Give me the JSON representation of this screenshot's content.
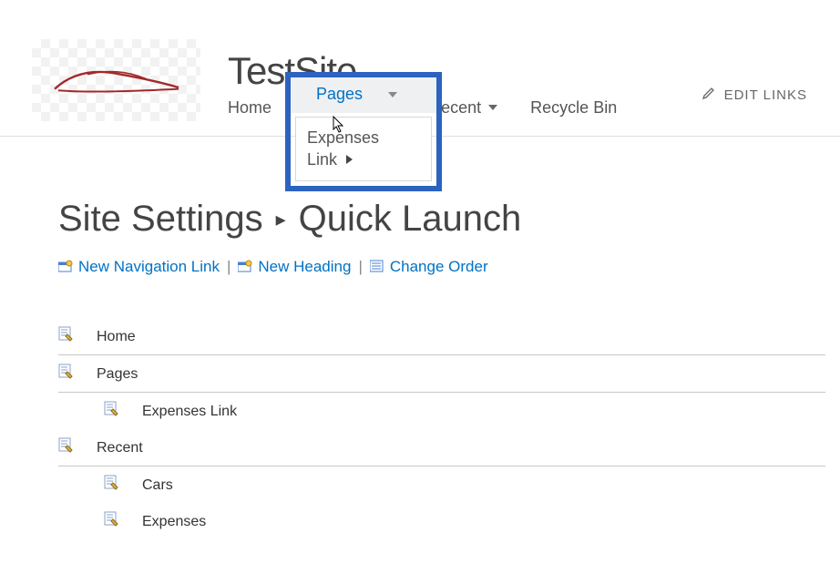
{
  "site_title": "TestSite",
  "topnav": {
    "home": "Home",
    "pages": "Pages",
    "recent_visible": "ecent",
    "recycle": "Recycle Bin"
  },
  "dropdown": {
    "item_line1": "Expenses",
    "item_line2": "Link"
  },
  "edit_links": "EDIT LINKS",
  "breadcrumb": {
    "site_settings": "Site Settings",
    "quick_launch": "Quick Launch"
  },
  "actions": {
    "new_nav_link": "New Navigation Link",
    "new_heading": "New Heading",
    "change_order": "Change Order"
  },
  "quick_launch": {
    "home": "Home",
    "pages": "Pages",
    "expenses_link": "Expenses Link",
    "recent": "Recent",
    "cars": "Cars",
    "expenses": "Expenses"
  }
}
